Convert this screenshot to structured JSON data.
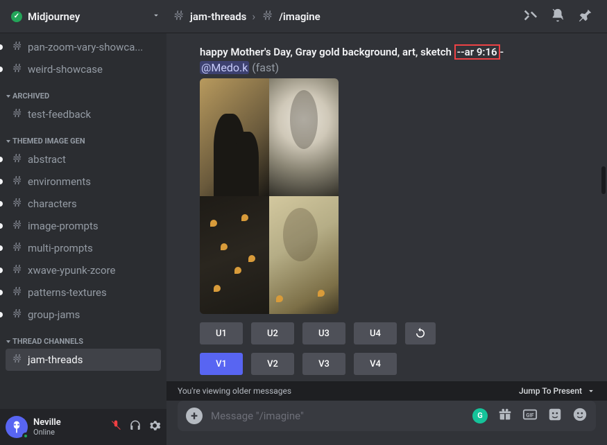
{
  "header": {
    "server_name": "Midjourney",
    "channel": "jam-threads",
    "thread": "/imagine"
  },
  "sidebar": {
    "top_channels": [
      {
        "name": "pan-zoom-vary-showca...",
        "unread": true
      },
      {
        "name": "weird-showcase",
        "unread": true
      }
    ],
    "sections": [
      {
        "title": "ARCHIVED",
        "channels": [
          {
            "name": "test-feedback"
          }
        ]
      },
      {
        "title": "THEMED IMAGE GEN",
        "channels": [
          {
            "name": "abstract",
            "unread": true
          },
          {
            "name": "environments",
            "unread": true
          },
          {
            "name": "characters",
            "unread": true
          },
          {
            "name": "image-prompts",
            "unread": true
          },
          {
            "name": "multi-prompts",
            "unread": true
          },
          {
            "name": "xwave-ypunk-zcore",
            "unread": true
          },
          {
            "name": "patterns-textures",
            "unread": true
          },
          {
            "name": "group-jams",
            "unread": true
          }
        ]
      },
      {
        "title": "THREAD CHANNELS",
        "channels": [
          {
            "name": "jam-threads",
            "active": true
          }
        ]
      }
    ]
  },
  "user": {
    "name": "Neville",
    "status": "Online"
  },
  "message": {
    "prompt_pre": "happy Mother's Day, Gray gold background, art, sketch ",
    "prompt_highlight": "--ar 9:16 ",
    "prompt_post": "-",
    "mention": "@Medo.k",
    "mode": "(fast)",
    "urow": [
      "U1",
      "U2",
      "U3",
      "U4"
    ],
    "vrow": [
      "V1",
      "V2",
      "V3",
      "V4"
    ]
  },
  "banner": {
    "text": "You're viewing older messages",
    "action": "Jump To Present"
  },
  "input": {
    "placeholder": "Message \"/imagine\""
  }
}
